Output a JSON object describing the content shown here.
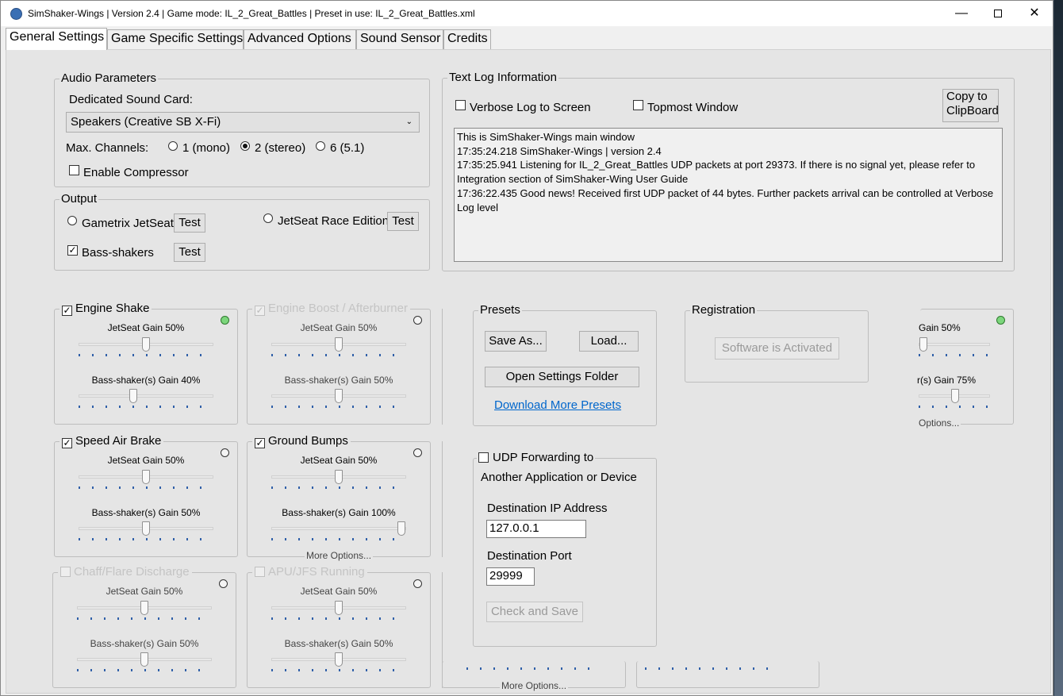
{
  "window": {
    "title": "SimShaker-Wings | Version 2.4 | Game mode: IL_2_Great_Battles | Preset in use: IL_2_Great_Battles.xml",
    "minimize": "—",
    "close": "✕"
  },
  "tabs": [
    {
      "label": "General Settings",
      "active": true
    },
    {
      "label": "Game Specific Settings"
    },
    {
      "label": "Advanced Options"
    },
    {
      "label": "Sound Sensor"
    },
    {
      "label": "Credits"
    }
  ],
  "audio": {
    "title": "Audio Parameters",
    "sound_card_label": "Dedicated Sound Card:",
    "sound_card_value": "Speakers (Creative SB X-Fi)",
    "max_channels_label": "Max. Channels:",
    "ch_mono": "1 (mono)",
    "ch_stereo": "2 (stereo)",
    "ch_51": "6 (5.1)",
    "selected_channel": "2 (stereo)",
    "compressor_label": "Enable Compressor",
    "compressor_checked": false
  },
  "output": {
    "title": "Output",
    "jetseat_label": "Gametrix JetSeat",
    "race_label": "JetSeat Race Edition",
    "bass_label": "Bass-shakers",
    "bass_checked": true,
    "test_label": "Test",
    "check_mark": "✓"
  },
  "log": {
    "title": "Text Log Information",
    "verbose_label": "Verbose Log to Screen",
    "topmost_label": "Topmost Window",
    "copy_label": "Copy to\nClipBoard",
    "text": "This is SimShaker-Wings main window\n17:35:24.218 SimShaker-Wings | version 2.4\n17:35:25.941 Listening for IL_2_Great_Battles UDP packets at port 29373. If there is no signal yet, please refer to Integration section of SimShaker-Wing User Guide\n17:36:22.435 Good news! Received first UDP packet of 44 bytes. Further packets arrival can be controlled at Verbose Log level"
  },
  "effects": [
    {
      "name": "Engine Shake",
      "checked": true,
      "enabled": true,
      "active": true,
      "jet_label": "JetSeat Gain 50%",
      "jet_value": 50,
      "bass_label": "Bass-shaker(s) Gain 40%",
      "bass_value": 40
    },
    {
      "name": "Engine Boost / Afterburner",
      "checked": true,
      "enabled": false,
      "active": false,
      "jet_label": "JetSeat Gain 50%",
      "jet_value": 50,
      "bass_label": "Bass-shaker(s) Gain 50%",
      "bass_value": 50
    },
    {
      "name": "Speed Air Brake",
      "checked": true,
      "enabled": true,
      "active": false,
      "jet_label": "JetSeat Gain 50%",
      "jet_value": 50,
      "bass_label": "Bass-shaker(s) Gain 50%",
      "bass_value": 50
    },
    {
      "name": "Ground Bumps",
      "checked": true,
      "enabled": true,
      "active": false,
      "jet_label": "JetSeat Gain 50%",
      "jet_value": 50,
      "bass_label": "Bass-shaker(s) Gain 100%",
      "bass_value": 100,
      "more": "More Options..."
    },
    {
      "name": "Chaff/Flare Discharge",
      "checked": false,
      "enabled": false,
      "active": false,
      "jet_label": "JetSeat Gain 50%",
      "jet_value": 50,
      "bass_label": "Bass-shaker(s) Gain 50%",
      "bass_value": 50
    },
    {
      "name": "APU/JFS Running",
      "checked": false,
      "enabled": false,
      "active": false,
      "jet_label": "JetSeat Gain 50%",
      "jet_value": 50,
      "bass_label": "Bass-shaker(s) Gain 50%",
      "bass_value": 50
    }
  ],
  "right_effect": {
    "jet_label_partial": "Gain 50%",
    "jet_value": 50,
    "bass_label_partial": "r(s) Gain 75%",
    "bass_value": 75,
    "more_partial": "Options..."
  },
  "bottom_more": "More Options...",
  "presets": {
    "title": "Presets",
    "save_as": "Save As...",
    "load": "Load...",
    "open_folder": "Open Settings Folder",
    "download": "Download More Presets"
  },
  "registration": {
    "title": "Registration",
    "status": "Software is Activated"
  },
  "udp": {
    "title_line1": "UDP Forwarding to",
    "title_line2": "Another Application or Device",
    "enabled": false,
    "ip_label": "Destination IP Address",
    "ip_value": "127.0.0.1",
    "port_label": "Destination Port",
    "port_value": "29999",
    "check_save": "Check and Save"
  },
  "colors": {
    "link": "#0066cc",
    "led_active": "#7cd67c",
    "tick": "#2f5fa8"
  }
}
